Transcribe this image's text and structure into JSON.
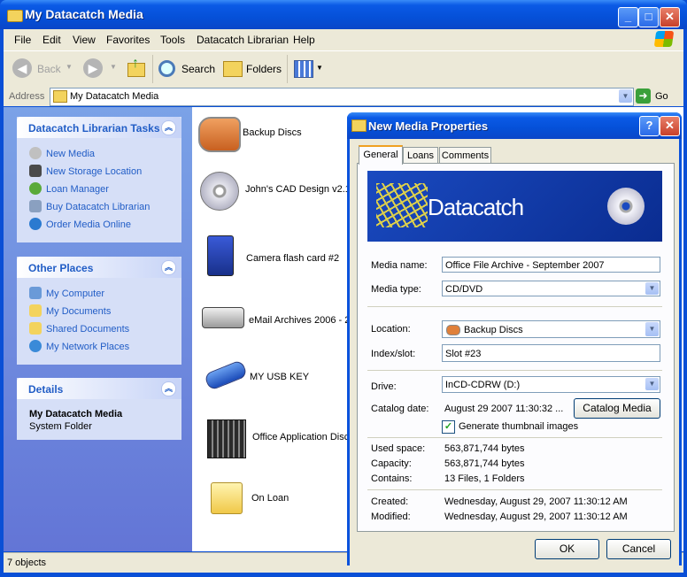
{
  "window": {
    "title": "My Datacatch Media"
  },
  "menu": [
    "File",
    "Edit",
    "View",
    "Favorites",
    "Tools",
    "Datacatch Librarian",
    "Help"
  ],
  "toolbar": {
    "back": "Back",
    "search": "Search",
    "folders": "Folders"
  },
  "address": {
    "label": "Address",
    "value": "My Datacatch Media",
    "go": "Go"
  },
  "tasks": {
    "title": "Datacatch Librarian Tasks",
    "items": [
      "New Media",
      "New Storage Location",
      "Loan Manager",
      "Buy Datacatch Librarian",
      "Order Media Online"
    ]
  },
  "other_places": {
    "title": "Other Places",
    "items": [
      "My Computer",
      "My Documents",
      "Shared Documents",
      "My Network Places"
    ]
  },
  "details": {
    "title": "Details",
    "name": "My Datacatch Media",
    "type": "System Folder"
  },
  "files": [
    "Backup Discs",
    "John's CAD Design v2.1",
    "Camera flash card #2",
    "eMail Archives 2006 - 2",
    "MY USB KEY",
    "Office Application Disc",
    "On Loan"
  ],
  "status": {
    "text": "7 objects"
  },
  "dialog": {
    "title": "New Media Properties",
    "tabs": [
      "General",
      "Loans",
      "Comments"
    ],
    "banner_text": "Datacatch",
    "labels": {
      "media_name": "Media name:",
      "media_type": "Media type:",
      "location": "Location:",
      "index_slot": "Index/slot:",
      "drive": "Drive:",
      "catalog_date": "Catalog date:",
      "used_space": "Used space:",
      "capacity": "Capacity:",
      "contains": "Contains:",
      "created": "Created:",
      "modified": "Modified:"
    },
    "values": {
      "media_name": "Office File Archive - September 2007",
      "media_type": "CD/DVD",
      "location": "Backup Discs",
      "index_slot": "Slot #23",
      "drive": "InCD-CDRW (D:)",
      "catalog_date": "August 29 2007 11:30:32 ...",
      "used_space": "563,871,744 bytes",
      "capacity": "563,871,744 bytes",
      "contains": "13 Files, 1 Folders",
      "created": "Wednesday, August 29, 2007 11:30:12 AM",
      "modified": "Wednesday, August 29, 2007 11:30:12 AM"
    },
    "catalog_button": "Catalog Media",
    "thumbnail_checkbox": "Generate thumbnail images",
    "thumbnail_checked": true,
    "ok": "OK",
    "cancel": "Cancel"
  }
}
